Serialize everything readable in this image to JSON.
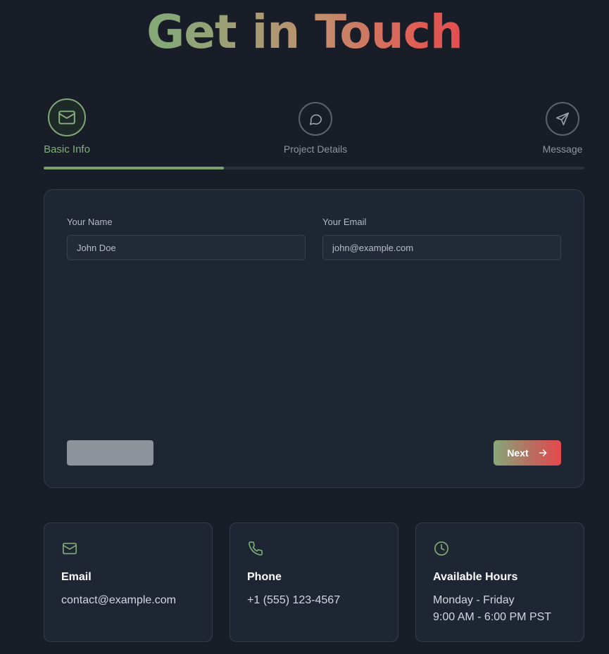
{
  "page": {
    "title": "Get in Touch"
  },
  "steps": [
    {
      "label": "Basic Info",
      "icon": "mail-icon",
      "state": "active"
    },
    {
      "label": "Project Details",
      "icon": "message-icon",
      "state": "inactive"
    },
    {
      "label": "Message",
      "icon": "send-icon",
      "state": "inactive"
    }
  ],
  "progress": {
    "fraction": 0.333
  },
  "form": {
    "name_label": "Your Name",
    "name_placeholder": "John Doe",
    "name_value": "",
    "email_label": "Your Email",
    "email_placeholder": "john@example.com",
    "email_value": "",
    "previous_label": "",
    "next_label": "Next"
  },
  "info_cards": [
    {
      "icon": "mail-icon",
      "title": "Email",
      "lines": [
        "contact@example.com"
      ]
    },
    {
      "icon": "phone-icon",
      "title": "Phone",
      "lines": [
        "+1 (555) 123-4567"
      ]
    },
    {
      "icon": "clock-icon",
      "title": "Available Hours",
      "lines": [
        "Monday - Friday",
        "9:00 AM - 6:00 PM PST"
      ]
    }
  ],
  "colors": {
    "background": "#181d28",
    "card": "#1e2633",
    "accent_green": "#7fab78",
    "accent_red": "#e5484d"
  }
}
